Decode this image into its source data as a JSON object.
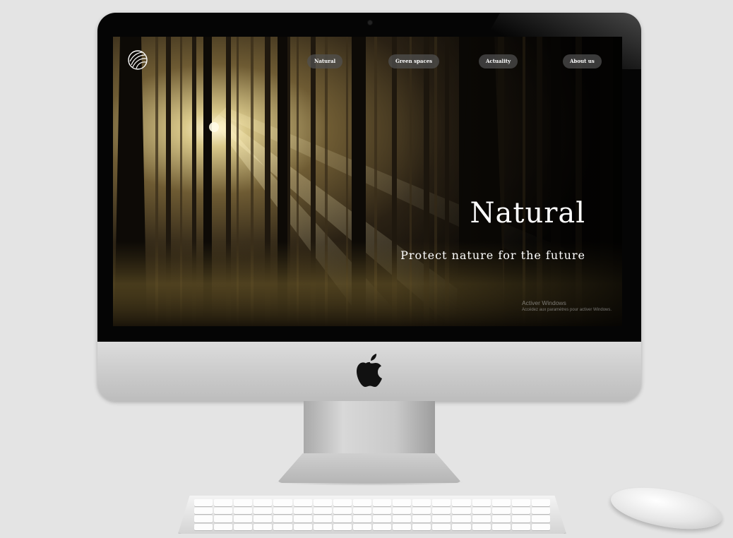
{
  "website": {
    "nav": {
      "items": [
        {
          "label": "Natural"
        },
        {
          "label": "Green spaces"
        },
        {
          "label": "Actuality"
        },
        {
          "label": "About us"
        }
      ]
    },
    "hero": {
      "title": "Natural",
      "subtitle": "Protect nature for the future"
    },
    "watermark": {
      "title": "Activer Windows",
      "subtitle": "Accédez aux paramètres pour activer Windows."
    },
    "icons": {
      "brand": "leaf-globe-icon"
    }
  },
  "device": {
    "monitor_logo_icon": "apple-icon",
    "colors": {
      "background": "#e4e4e4",
      "bezel": "#050505",
      "aluminum": "#c9c9c9",
      "nav_pill": "#505050",
      "hero_text": "#ffffff"
    }
  }
}
